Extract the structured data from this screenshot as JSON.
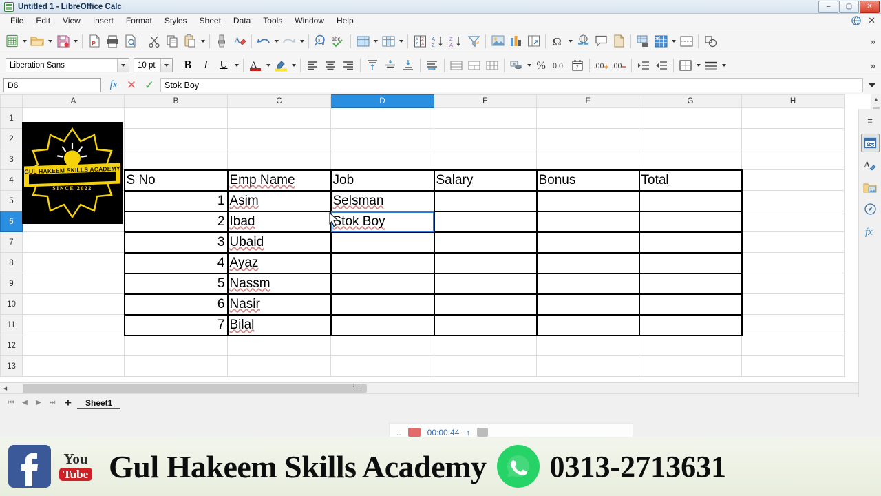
{
  "window": {
    "title": "Untitled 1 - LibreOffice Calc",
    "app_icon": "calc-document-icon",
    "minimize": "–",
    "maximize": "▢",
    "close": "✕"
  },
  "menubar": {
    "items": [
      {
        "label": "File",
        "accel": "F"
      },
      {
        "label": "Edit",
        "accel": "E"
      },
      {
        "label": "View",
        "accel": "V"
      },
      {
        "label": "Insert",
        "accel": "I"
      },
      {
        "label": "Format",
        "accel": "o"
      },
      {
        "label": "Styles",
        "accel": "y"
      },
      {
        "label": "Sheet",
        "accel": "S"
      },
      {
        "label": "Data",
        "accel": "D"
      },
      {
        "label": "Tools",
        "accel": "T"
      },
      {
        "label": "Window",
        "accel": "W"
      },
      {
        "label": "Help",
        "accel": "H"
      }
    ],
    "right_icons": [
      "globe-icon",
      "close-document-icon"
    ]
  },
  "standard_toolbar": {
    "items": [
      "new-document-icon",
      "open-file-icon",
      "save-icon",
      "export-pdf-icon",
      "print-icon",
      "print-preview-icon",
      "cut-icon",
      "copy-icon",
      "paste-icon",
      "clone-formatting-icon",
      "clear-formatting-icon",
      "undo-icon",
      "redo-icon",
      "find-and-replace-icon",
      "spelling-icon",
      "row-icon",
      "column-icon",
      "sort-icon",
      "sort-ascending-icon",
      "sort-descending-icon",
      "autofilter-icon",
      "insert-image-icon",
      "insert-chart-icon",
      "pivot-table-icon",
      "special-character-icon",
      "hyperlink-icon",
      "comment-icon",
      "headers-footers-icon",
      "freeze-rows-columns-icon",
      "define-print-area-icon",
      "split-window-icon",
      "show-draw-functions-icon"
    ],
    "overflow": "»"
  },
  "formatting_toolbar": {
    "font_name": "Liberation Sans",
    "font_size": "10 pt",
    "bold": "B",
    "italic": "I",
    "underline": "U",
    "items": [
      "font-color-icon",
      "highlight-color-icon",
      "align-left-icon",
      "align-center-icon",
      "align-right-icon",
      "align-top-icon",
      "center-vertically-icon",
      "align-bottom-icon",
      "wrap-text-icon",
      "merge-cells-icon",
      "merge-center-icon",
      "unmerge-cells-icon",
      "currency-format-icon",
      "percent-format-icon",
      "number-format-icon",
      "date-format-icon",
      "add-decimal-icon",
      "delete-decimal-icon",
      "increase-indent-icon",
      "decrease-indent-icon",
      "borders-icon",
      "border-style-icon"
    ],
    "overflow": "»"
  },
  "formula_bar": {
    "name_box": "D6",
    "function_wizard": "fx",
    "reject": "✕",
    "accept": "✓",
    "input_line": "Stok Boy",
    "expand": "▼"
  },
  "grid": {
    "columns": [
      "A",
      "B",
      "C",
      "D",
      "E",
      "F",
      "G",
      "H"
    ],
    "selected_column": "D",
    "rows": [
      "1",
      "2",
      "3",
      "4",
      "5",
      "6",
      "7",
      "8",
      "9",
      "10",
      "11",
      "12",
      "13"
    ],
    "selected_row": "6",
    "active_cell": "D6",
    "table": {
      "headers": [
        "S No",
        "Emp Name",
        "Job",
        "Salary",
        "Bonus",
        "Total"
      ],
      "rows": [
        {
          "s_no": "1",
          "emp_name": "Asim",
          "job": "Selsman",
          "salary": "",
          "bonus": "",
          "total": ""
        },
        {
          "s_no": "2",
          "emp_name": "Ibad",
          "job": "Stok Boy",
          "salary": "",
          "bonus": "",
          "total": ""
        },
        {
          "s_no": "3",
          "emp_name": "Ubaid",
          "job": "",
          "salary": "",
          "bonus": "",
          "total": ""
        },
        {
          "s_no": "4",
          "emp_name": "Ayaz",
          "job": "",
          "salary": "",
          "bonus": "",
          "total": ""
        },
        {
          "s_no": "5",
          "emp_name": "Nassm",
          "job": "",
          "salary": "",
          "bonus": "",
          "total": ""
        },
        {
          "s_no": "6",
          "emp_name": "Nasir",
          "job": "",
          "salary": "",
          "bonus": "",
          "total": ""
        },
        {
          "s_no": "7",
          "emp_name": "Bilal",
          "job": "",
          "salary": "",
          "bonus": "",
          "total": ""
        }
      ]
    },
    "logo": {
      "name": "GUL HAKEEM SKILLS ACADEMY",
      "since": "SINCE 2022",
      "background": "#000000",
      "accent": "#f5d20c"
    }
  },
  "sheet_tabs": {
    "first": "⏮",
    "previous": "◀",
    "next": "▶",
    "last": "⏭",
    "add_sheet": "+",
    "tabs": [
      "Sheet1"
    ],
    "active": "Sheet1"
  },
  "sidebar": {
    "items": [
      {
        "name": "sidebar-settings-icon",
        "label": "≡"
      },
      {
        "name": "properties-icon",
        "label": ""
      },
      {
        "name": "styles-icon",
        "label": ""
      },
      {
        "name": "gallery-icon",
        "label": ""
      },
      {
        "name": "navigator-icon",
        "label": ""
      },
      {
        "name": "functions-icon",
        "label": ""
      }
    ]
  },
  "banner": {
    "facebook": "facebook-icon",
    "youtube_you": "You",
    "youtube_tube": "Tube",
    "title": "Gul Hakeem Skills Academy",
    "whatsapp": "whatsapp-icon",
    "phone": "0313-2713631"
  }
}
